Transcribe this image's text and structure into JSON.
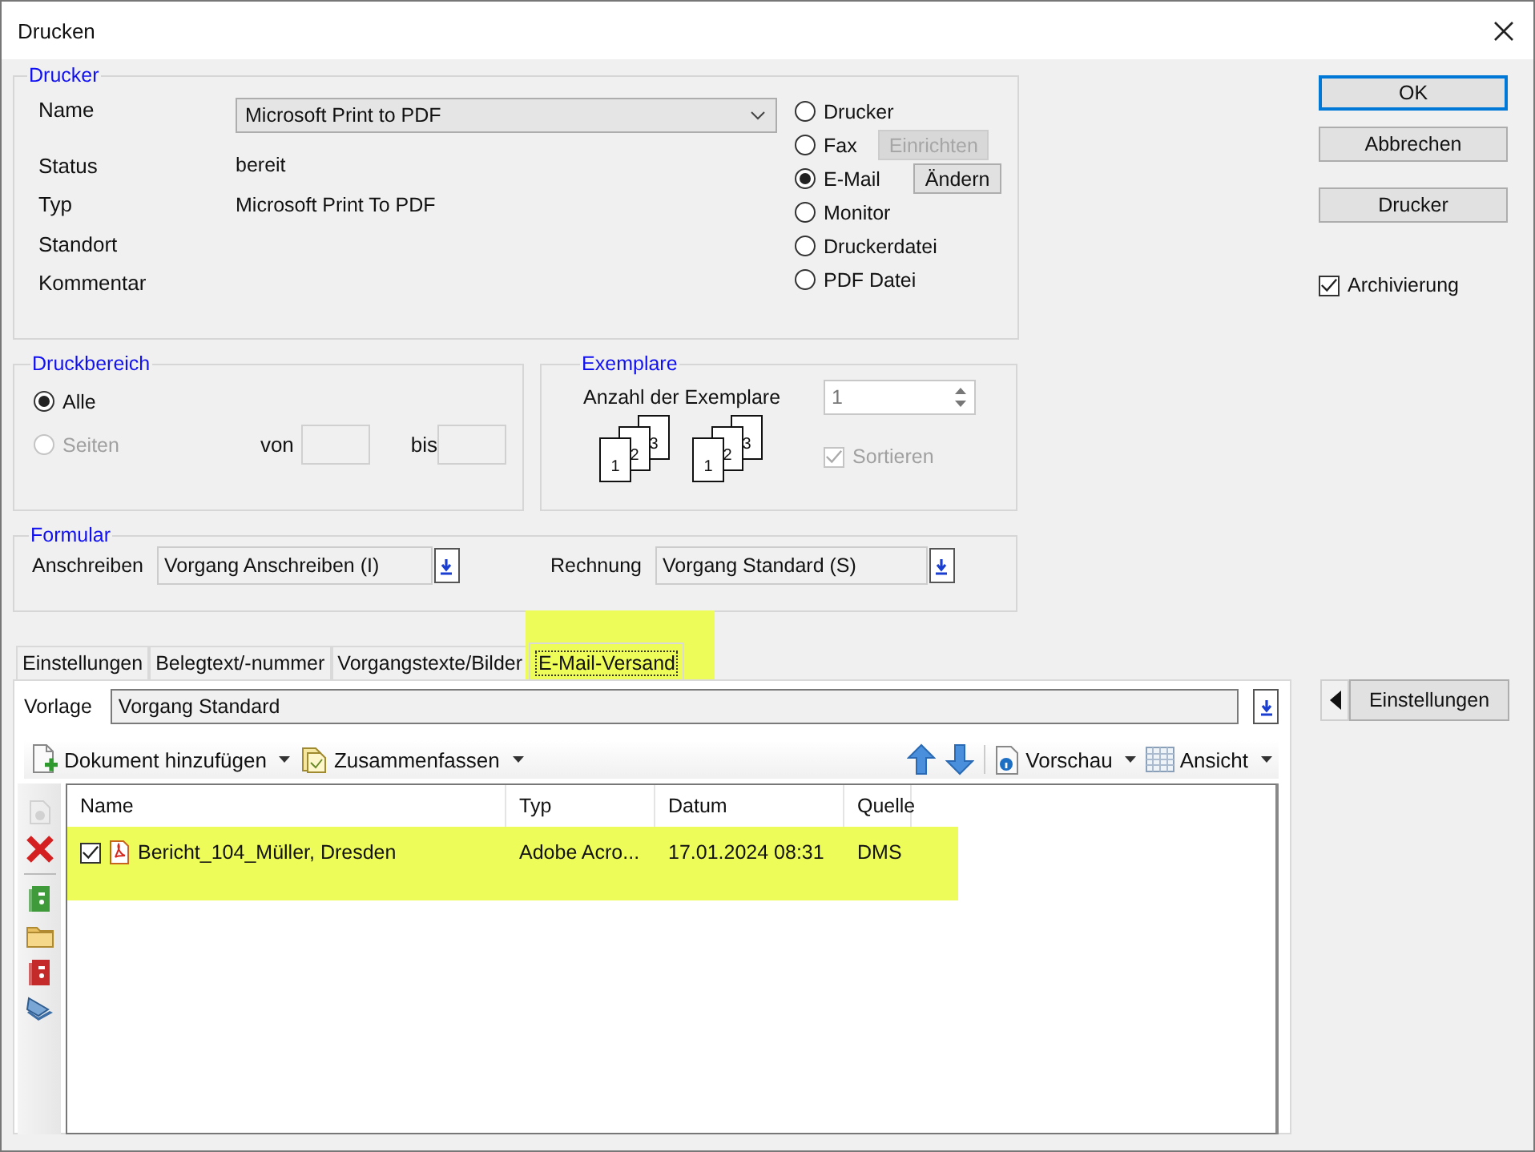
{
  "window": {
    "title": "Drucken"
  },
  "printer": {
    "legend": "Drucker",
    "fields": [
      {
        "label": "Name",
        "value": "Microsoft Print to PDF",
        "kind": "select"
      },
      {
        "label": "Status",
        "value": "bereit",
        "kind": "text"
      },
      {
        "label": "Typ",
        "value": "Microsoft Print To PDF",
        "kind": "text"
      },
      {
        "label": "Standort",
        "kind": "text"
      },
      {
        "label": "Kommentar",
        "kind": "text"
      }
    ],
    "outputs": [
      {
        "label": "Drucker",
        "selected": false
      },
      {
        "label": "Fax",
        "selected": false,
        "button": {
          "label": "Einrichten",
          "disabled": true
        }
      },
      {
        "label": "E-Mail",
        "selected": true,
        "button": {
          "label": "Ändern",
          "disabled": false
        }
      },
      {
        "label": "Monitor",
        "selected": false
      },
      {
        "label": "Druckerdatei",
        "selected": false
      },
      {
        "label": "PDF Datei",
        "selected": false
      }
    ]
  },
  "buttons": [
    {
      "label": "OK",
      "default": true
    },
    {
      "label": "Abbrechen",
      "default": false
    },
    {
      "label": "Drucker",
      "default": false
    }
  ],
  "archiving": {
    "label": "Archivierung",
    "checked": true
  },
  "range": {
    "legend": "Druckbereich",
    "options": [
      {
        "label": "Alle",
        "selected": true,
        "disabled": false
      },
      {
        "label": "Seiten",
        "selected": false,
        "disabled": true
      }
    ],
    "from_label": "von",
    "to_label": "bis"
  },
  "copies": {
    "legend": "Exemplare",
    "label": "Anzahl der Exemplare",
    "value": "1",
    "stacks": [
      [
        "1",
        "2",
        "3"
      ],
      [
        "1",
        "2",
        "3"
      ]
    ],
    "collate": {
      "label": "Sortieren",
      "checked": true,
      "disabled": true
    }
  },
  "form": {
    "legend": "Formular",
    "fields": [
      {
        "label": "Anschreiben",
        "value": "Vorgang Anschreiben (I)"
      },
      {
        "label": "Rechnung",
        "value": "Vorgang Standard (S)"
      }
    ]
  },
  "tabs": [
    {
      "label": "Einstellungen",
      "selected": false,
      "highlighted": false
    },
    {
      "label": "Belegtext/-nummer",
      "selected": false,
      "highlighted": false
    },
    {
      "label": "Vorgangstexte/Bilder",
      "selected": false,
      "highlighted": false
    },
    {
      "label": "E-Mail-Versand",
      "selected": true,
      "highlighted": true
    }
  ],
  "template": {
    "label": "Vorlage",
    "value": "Vorgang Standard"
  },
  "toolbar_left": [
    {
      "kind": "add",
      "label": "Dokument hinzufügen",
      "menu": true
    },
    {
      "kind": "merge",
      "label": "Zusammenfassen",
      "menu": true
    }
  ],
  "toolbar_right": [
    {
      "kind": "up"
    },
    {
      "kind": "down"
    },
    {
      "kind": "preview",
      "label": "Vorschau",
      "menu": true
    },
    {
      "kind": "view",
      "label": "Ansicht",
      "menu": true
    }
  ],
  "side_tools": [
    {
      "kind": "info",
      "disabled": true
    },
    {
      "kind": "delete",
      "disabled": false
    },
    {
      "kind": "binder",
      "color": "#3f9a3a",
      "disabled": false
    },
    {
      "kind": "folder",
      "disabled": false
    },
    {
      "kind": "binder",
      "color": "#c42a2a",
      "disabled": false
    },
    {
      "kind": "scanner",
      "disabled": false
    }
  ],
  "documents": {
    "columns": [
      "Name",
      "Typ",
      "Datum",
      "Quelle"
    ],
    "rows": [
      {
        "checked": true,
        "highlighted": true,
        "cells": [
          "Bericht_104_Müller, Dresden",
          "Adobe Acro...",
          "17.01.2024 08:31",
          "DMS"
        ]
      }
    ]
  },
  "side_button": {
    "label": "Einstellungen"
  }
}
